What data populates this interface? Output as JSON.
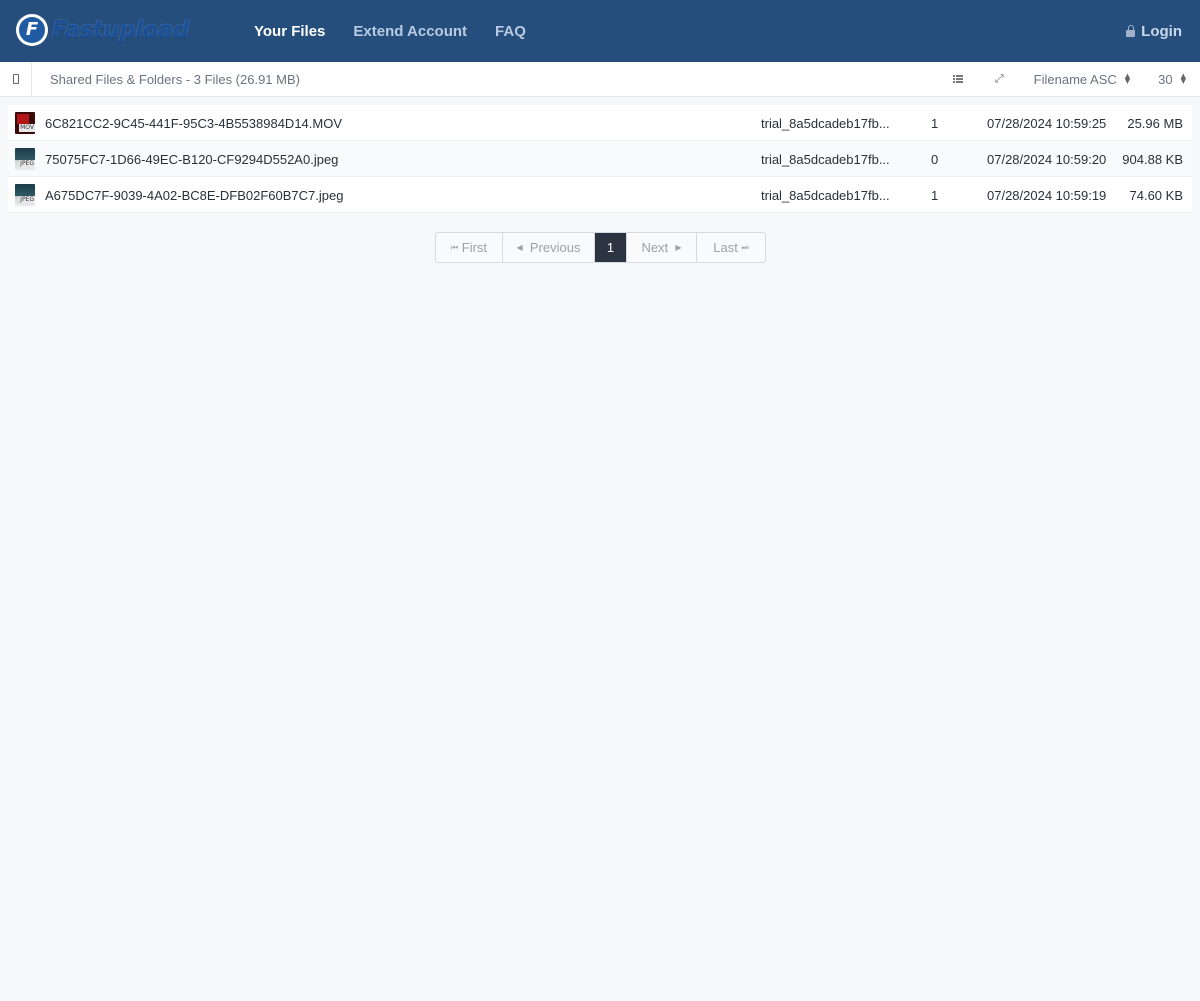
{
  "app": {
    "logo_text": "Fastupload",
    "logo_letter": "F"
  },
  "nav": {
    "items": [
      {
        "label": "Your Files"
      },
      {
        "label": "Extend Account"
      },
      {
        "label": "FAQ"
      }
    ],
    "login_label": "Login"
  },
  "toolbar": {
    "breadcrumb": "Shared Files & Folders - 3 Files (26.91 MB)",
    "sort_label": "Filename ASC",
    "per_page": "30",
    "list_view_icon": "list-icon",
    "expand_icon": "expand-icon"
  },
  "files": [
    {
      "name": "6C821CC2-9C45-441F-95C3-4B5538984D14.MOV",
      "type": "MOV",
      "owner": "trial_8a5dcadeb17fb...",
      "downloads": "1",
      "date": "07/28/2024 10:59:25",
      "size": "25.96 MB"
    },
    {
      "name": "75075FC7-1D66-49EC-B120-CF9294D552A0.jpeg",
      "type": "JPEG",
      "owner": "trial_8a5dcadeb17fb...",
      "downloads": "0",
      "date": "07/28/2024 10:59:20",
      "size": "904.88 KB"
    },
    {
      "name": "A675DC7F-9039-4A02-BC8E-DFB02F60B7C7.jpeg",
      "type": "JPEG",
      "owner": "trial_8a5dcadeb17fb...",
      "downloads": "1",
      "date": "07/28/2024 10:59:19",
      "size": "74.60 KB"
    }
  ],
  "pagination": {
    "first": "First",
    "previous": "Previous",
    "current": "1",
    "next": "Next",
    "last": "Last"
  },
  "colors": {
    "header_bg": "#254e7c",
    "active_page_bg": "#2b3440",
    "page_bg": "#f6f8fa"
  }
}
